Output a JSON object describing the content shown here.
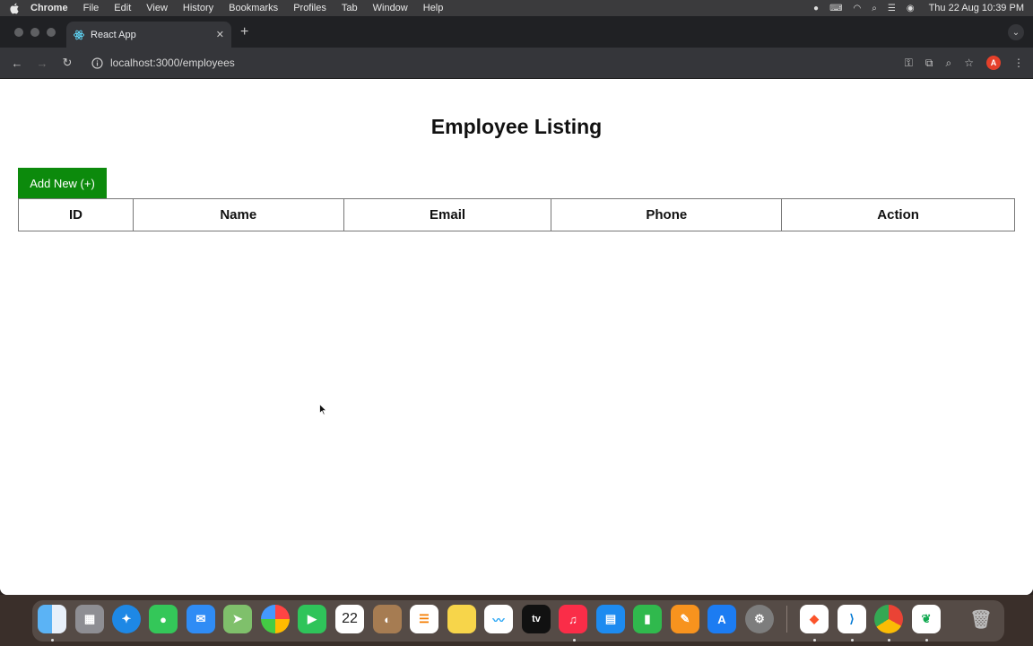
{
  "menubar": {
    "app": "Chrome",
    "items": [
      "File",
      "Edit",
      "View",
      "History",
      "Bookmarks",
      "Profiles",
      "Tab",
      "Window",
      "Help"
    ],
    "clock": "Thu 22 Aug  10:39 PM"
  },
  "browser": {
    "tab_title": "React App",
    "url": "localhost:3000/employees",
    "profile_initial": "A"
  },
  "page": {
    "title": "Employee Listing",
    "add_button": "Add New (+)",
    "columns": [
      "ID",
      "Name",
      "Email",
      "Phone",
      "Action"
    ]
  },
  "dock": {
    "calendar_day": "22",
    "tv_label": "tv"
  },
  "colors": {
    "add_button": "#0c8a0c",
    "menubar": "#3b3b3d",
    "tabstrip": "#202124",
    "toolbar": "#35363a"
  }
}
